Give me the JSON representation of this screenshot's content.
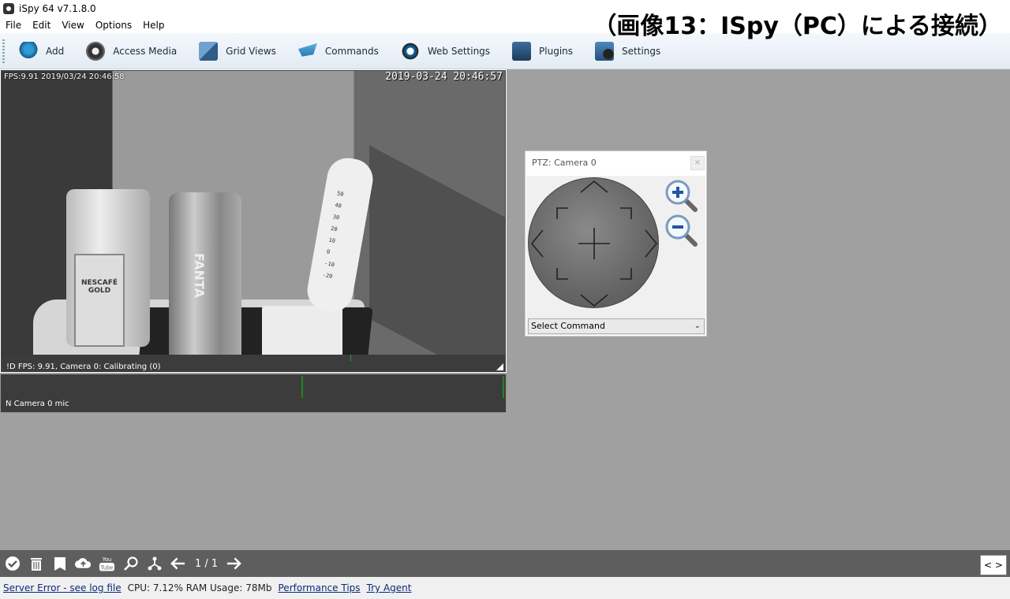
{
  "window": {
    "title": "iSpy 64 v7.1.8.0"
  },
  "caption": "（画像13：ISpy（PC）による接続）",
  "menu": [
    "File",
    "Edit",
    "View",
    "Options",
    "Help"
  ],
  "toolbar": [
    {
      "label": "Add",
      "icon": "add-camera-icon"
    },
    {
      "label": "Access Media",
      "icon": "access-media-icon"
    },
    {
      "label": "Grid Views",
      "icon": "grid-views-icon"
    },
    {
      "label": "Commands",
      "icon": "commands-icon"
    },
    {
      "label": "Web Settings",
      "icon": "web-settings-icon"
    },
    {
      "label": "Plugins",
      "icon": "plugins-icon"
    },
    {
      "label": "Settings",
      "icon": "settings-icon"
    }
  ],
  "camera": {
    "osd_fps": "FPS:9.91 2019/03/24 20:46:58",
    "osd_timestamp": "2019-03-24 20:46:57",
    "status_text": "!D  FPS: 9.91, Camera 0: Calibrating (0)",
    "thermometer_scale": [
      "50",
      "40",
      "30",
      "20",
      "10",
      "0",
      "-10",
      "-20"
    ],
    "jar_brand": "NESCAFÉ GOLD",
    "can_brand": "FANTA"
  },
  "mic": {
    "label": "N  Camera 0 mic"
  },
  "ptz": {
    "title": "PTZ: Camera 0",
    "close": "×",
    "select_command": "Select Command"
  },
  "bottom_toolbar": {
    "page_indicator": "1 / 1",
    "youtube_label": "You Tube"
  },
  "status": {
    "server_error": "Server Error - see log file",
    "usage": "CPU: 7.12% RAM Usage: 78Mb",
    "performance_tips": "Performance Tips",
    "try_agent": "Try Agent"
  }
}
